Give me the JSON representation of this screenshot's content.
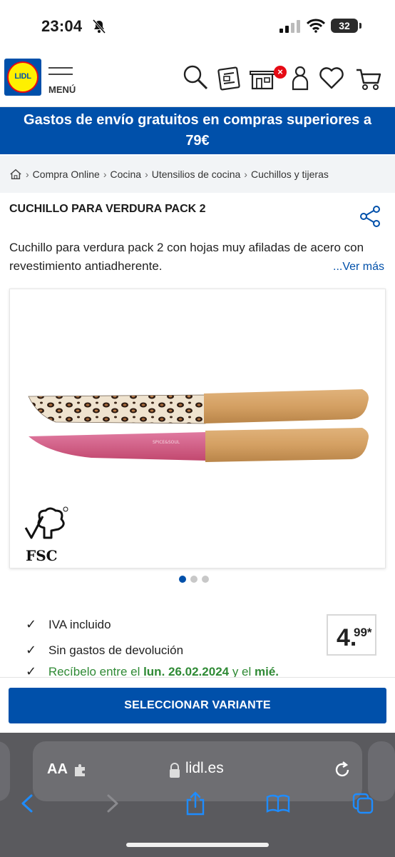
{
  "status_bar": {
    "time": "23:04",
    "battery": "32"
  },
  "header": {
    "logo_text": "LIDL",
    "menu_label": "MENÚ",
    "icons": [
      "search-icon",
      "leaflet-icon",
      "store-icon",
      "account-icon",
      "wishlist-icon",
      "cart-icon"
    ],
    "badge": "×"
  },
  "promo": {
    "text": "Gastos de envío gratuitos en compras superiores a 79€"
  },
  "breadcrumb": {
    "items": [
      "Compra Online",
      "Cocina",
      "Utensilios de cocina",
      "Cuchillos y tijeras"
    ]
  },
  "product": {
    "title": "CUCHILLO PARA VERDURA PACK 2",
    "description": "Cuchillo para verdura pack 2 con hojas muy afiladas de acero con revestimiento antiadherente.",
    "ver_mas": "...Ver más",
    "image_logo": "FSC",
    "knife_label": "SPICE&SOUL",
    "gallery_count": 3,
    "gallery_active": 1
  },
  "info": {
    "iva": "IVA incluido",
    "devolucion": "Sin gastos de devolución",
    "delivery_prefix": "Recíbelo entre el ",
    "delivery_date": "lun. 26.02.2024",
    "delivery_mid": " y el ",
    "delivery_end": "mié."
  },
  "price": {
    "int": "4.",
    "dec": "99*"
  },
  "cta": {
    "label": "SELECCIONAR VARIANTE"
  },
  "browser": {
    "aa": "AA",
    "url": "lidl.es"
  },
  "colors": {
    "brand_blue": "#0050aa",
    "brand_yellow": "#fff000",
    "brand_red": "#e60a14"
  }
}
